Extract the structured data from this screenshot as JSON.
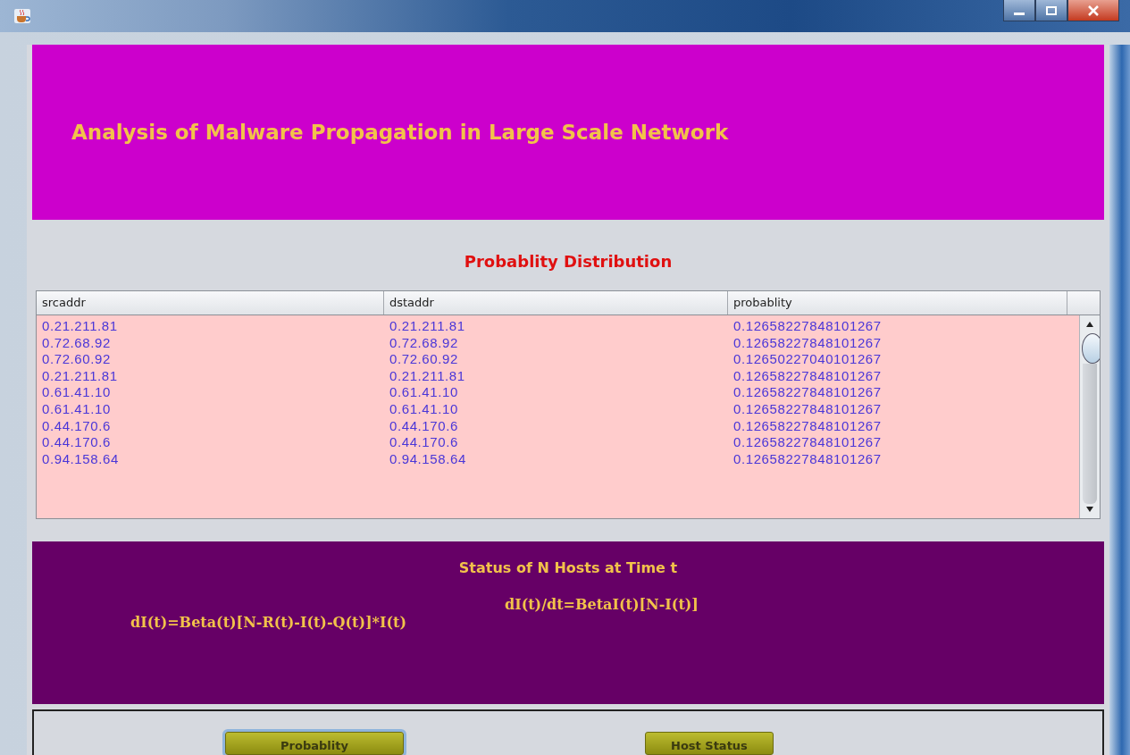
{
  "header": {
    "title": "Analysis of Malware Propagation in Large Scale Network"
  },
  "section_title": "Probablity Distribution",
  "table": {
    "columns": [
      "srcaddr",
      "dstaddr",
      "probablity"
    ],
    "rows": [
      [
        "0.21.211.81",
        "0.21.211.81",
        "0.12658227848101267"
      ],
      [
        "0.72.68.92",
        "0.72.68.92",
        "0.12658227848101267"
      ],
      [
        "0.72.60.92",
        "0.72.60.92",
        "0.12650227040101267"
      ],
      [
        "0.21.211.81",
        "0.21.211.81",
        "0.12658227848101267"
      ],
      [
        "0.61.41.10",
        "0.61.41.10",
        "0.12658227848101267"
      ],
      [
        "0.61.41.10",
        "0.61.41.10",
        "0.12658227848101267"
      ],
      [
        "0.44.170.6",
        "0.44.170.6",
        "0.12658227848101267"
      ],
      [
        "0.44.170.6",
        "0.44.170.6",
        "0.12658227848101267"
      ],
      [
        "0.94.158.64",
        "0.94.158.64",
        "0.12658227848101267"
      ]
    ]
  },
  "status_panel": {
    "title": "Status of N Hosts at Time t",
    "formulas": [
      "dI(t)=Beta(t)[N-R(t)-I(t)-Q(t)]*I(t)",
      "dI(t)/dt=BetaI(t)[N-I(t)]"
    ]
  },
  "buttons": [
    {
      "label": "Probablity",
      "selected": true
    },
    {
      "label": "Host Status",
      "selected": false
    }
  ]
}
